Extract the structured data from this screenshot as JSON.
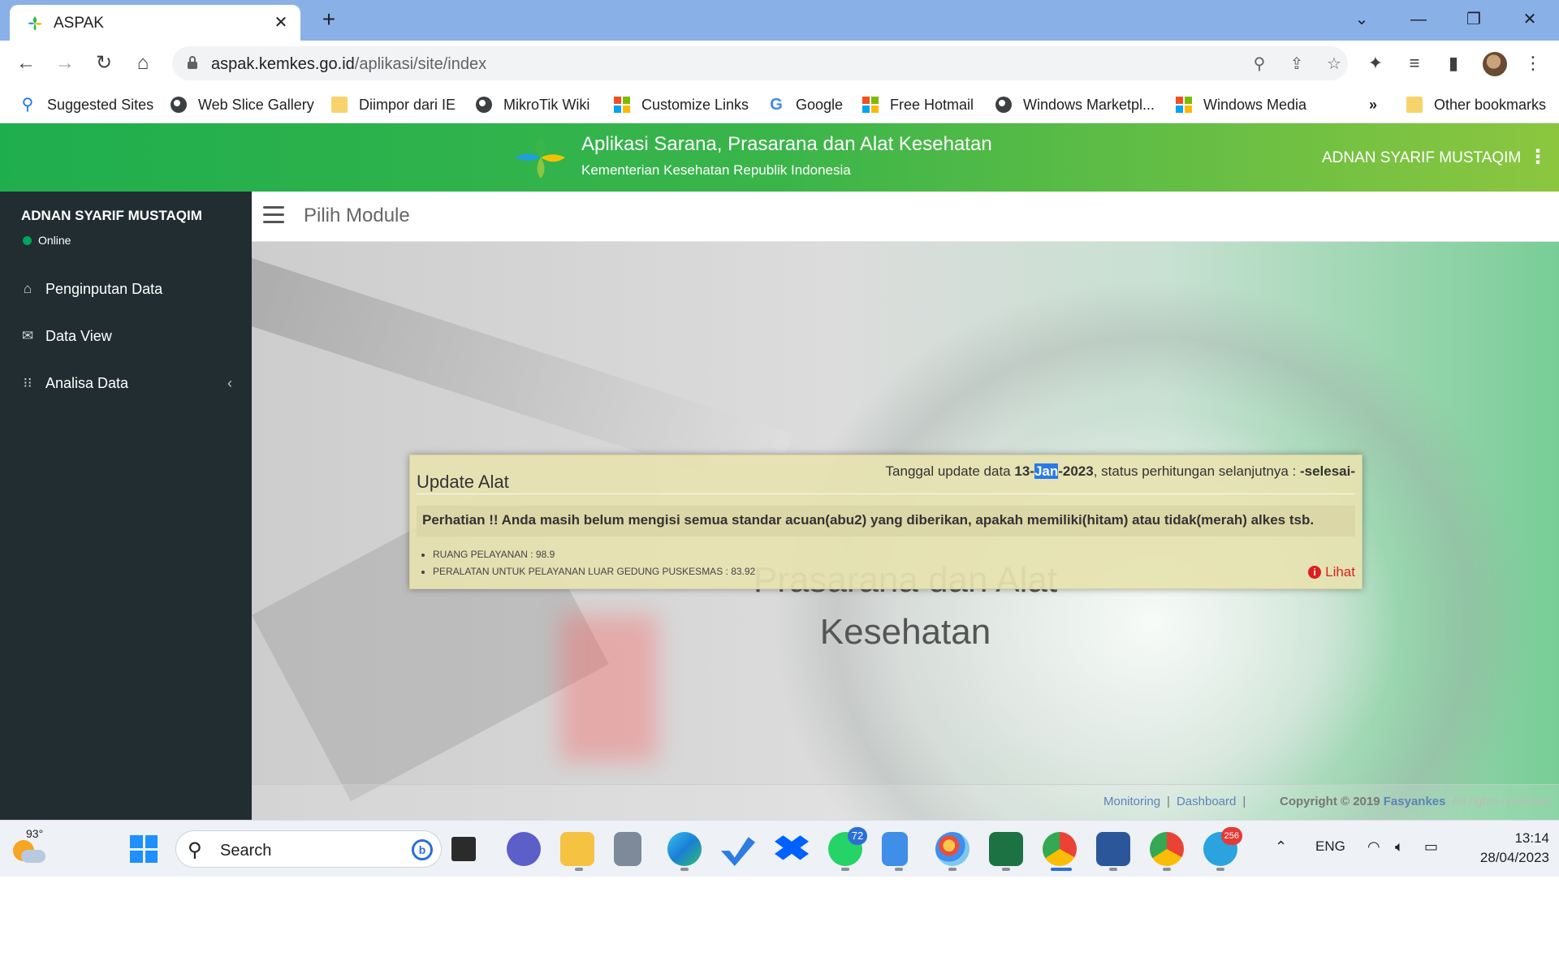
{
  "browser": {
    "tab_title": "ASPAK",
    "url_host": "aspak.kemkes.go.id",
    "url_path": "/aplikasi/site/index",
    "bookmarks": [
      {
        "label": "Suggested Sites",
        "icon": "search-icon"
      },
      {
        "label": "Web Slice Gallery",
        "icon": "globe-icon"
      },
      {
        "label": "Diimpor dari IE",
        "icon": "folder-icon"
      },
      {
        "label": "MikroTik Wiki",
        "icon": "globe-icon"
      },
      {
        "label": "Customize Links",
        "icon": "windows-icon"
      },
      {
        "label": "Google",
        "icon": "google-icon"
      },
      {
        "label": "Free Hotmail",
        "icon": "windows-icon"
      },
      {
        "label": "Windows Marketpl...",
        "icon": "globe-icon"
      },
      {
        "label": "Windows Media",
        "icon": "windows-icon"
      }
    ],
    "overflow_label": "»",
    "other_bookmarks": "Other bookmarks"
  },
  "app": {
    "title": "Aplikasi Sarana, Prasarana dan Alat Kesehatan",
    "subtitle": "Kementerian Kesehatan Republik Indonesia",
    "user_name": "ADNAN SYARIF MUSTAQIM",
    "header_color": "#3ab54a"
  },
  "sidebar": {
    "user_name": "ADNAN SYARIF MUSTAQIM",
    "status": "Online",
    "items": [
      {
        "label": "Penginputan Data",
        "icon": "home-icon"
      },
      {
        "label": "Data View",
        "icon": "envelope-icon"
      },
      {
        "label": "Analisa Data",
        "icon": "grid-icon"
      }
    ]
  },
  "content": {
    "page_title": "Pilih Module",
    "hero_line1": "Prasarana dan Alat",
    "hero_line2": "Kesehatan"
  },
  "popup": {
    "title": "Update Alat",
    "info_prefix": "Tanggal update data ",
    "date_day": "13-",
    "date_month": "Jan",
    "date_year": "-2023",
    "info_mid": ", status perhitungan selanjutnya : ",
    "info_status": "-selesai-",
    "alert": "Perhatian !! Anda masih belum mengisi semua standar acuan(abu2) yang diberikan, apakah memiliki(hitam) atau tidak(merah) alkes tsb.",
    "items": [
      "RUANG PELAYANAN : 98.9",
      "PERALATAN UNTUK PELAYANAN LUAR GEDUNG PUSKESMAS : 83.92"
    ],
    "action_label": "Lihat"
  },
  "footer": {
    "link_monitoring": "Monitoring",
    "link_dashboard": "Dashboard",
    "separator": "|",
    "copyright": "Copyright © 2019",
    "brand": "Fasyankes",
    "rights": ". All rights reserved."
  },
  "taskbar": {
    "temperature": "93°",
    "search_placeholder": "Search",
    "whatsapp_badge": "72",
    "telegram_badge": "256",
    "language": "ENG",
    "time": "13:14",
    "date": "28/04/2023"
  }
}
